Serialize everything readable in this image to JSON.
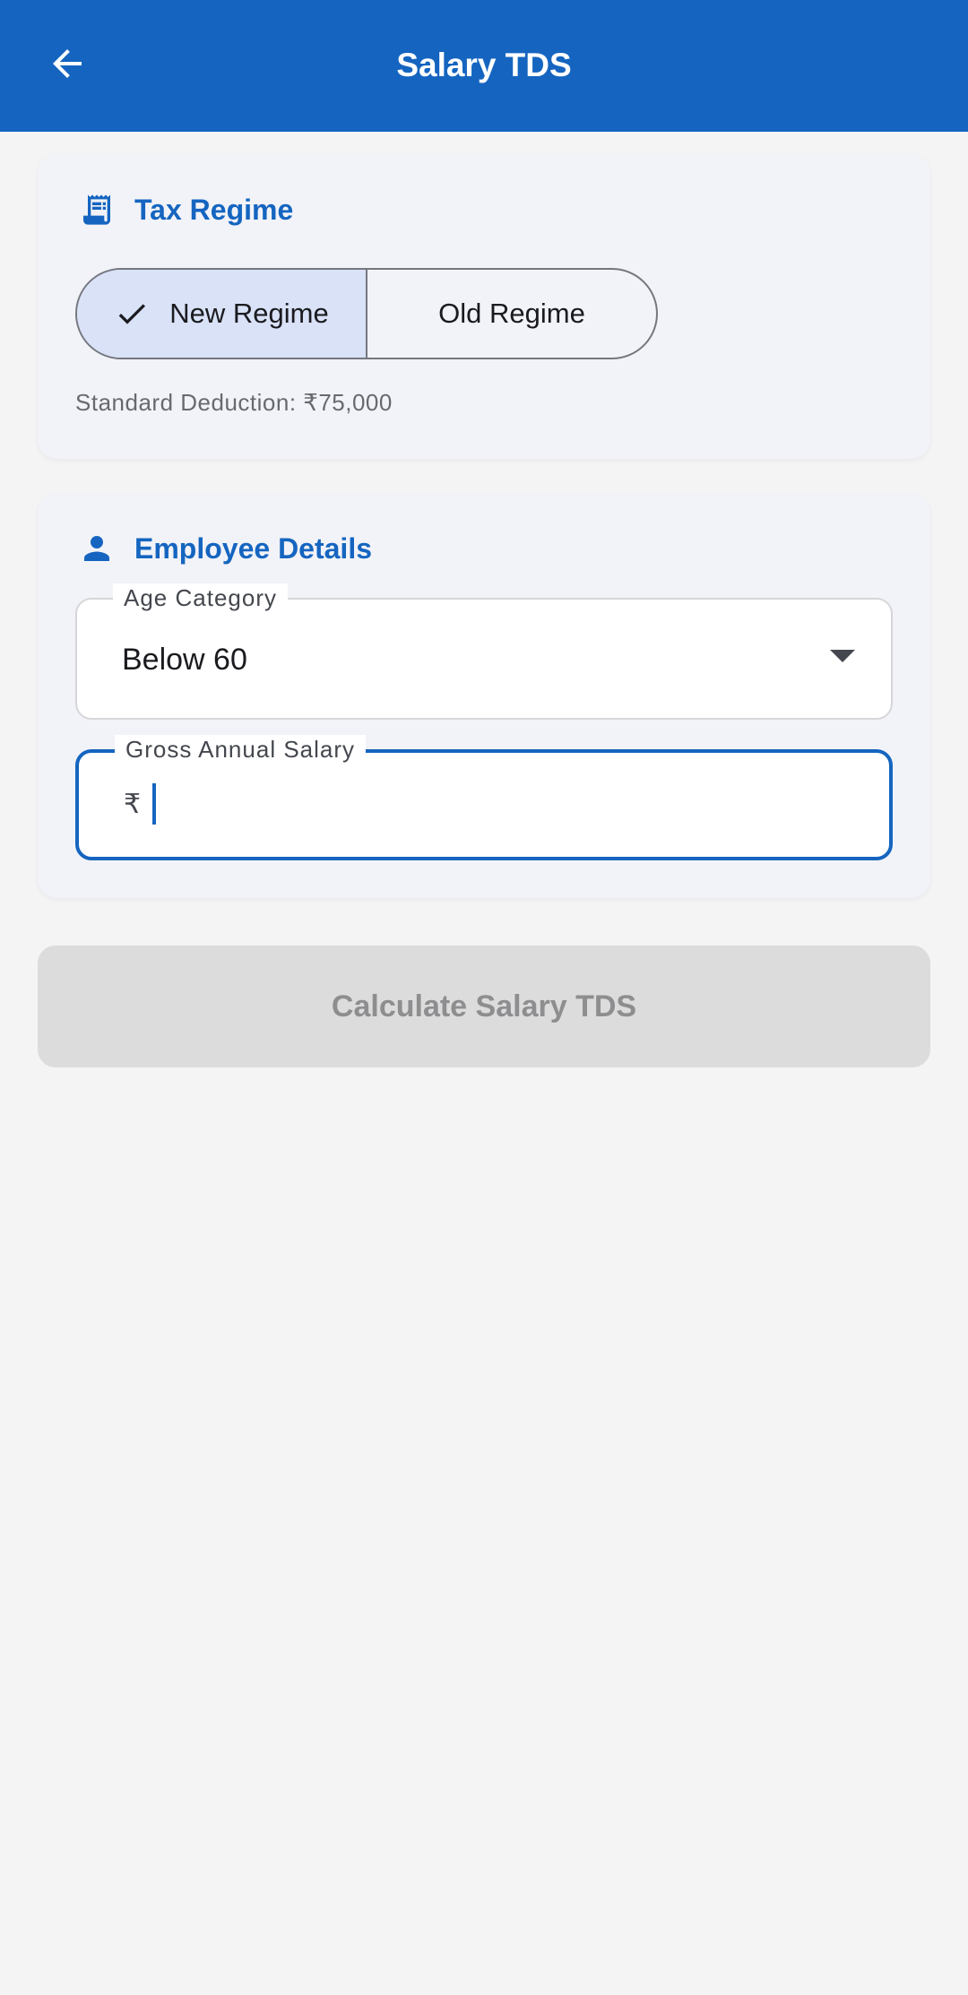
{
  "appbar": {
    "title": "Salary TDS",
    "back_icon": "arrow-left-icon"
  },
  "tax_regime": {
    "title": "Tax Regime",
    "icon": "receipt-icon",
    "options": [
      {
        "label": "New Regime",
        "selected": true
      },
      {
        "label": "Old Regime",
        "selected": false
      }
    ],
    "standard_deduction": "Standard Deduction: ₹75,000"
  },
  "employee": {
    "title": "Employee Details",
    "icon": "person-icon",
    "age_category": {
      "label": "Age Category",
      "value": "Below 60"
    },
    "gross_salary": {
      "label": "Gross Annual Salary",
      "prefix": "₹",
      "value": ""
    }
  },
  "calculate_button": {
    "label": "Calculate Salary TDS",
    "enabled": false
  },
  "colors": {
    "primary": "#1565c0",
    "background": "#f4f4f5",
    "card": "#f2f3f8",
    "selected_segment": "#d9e2f7",
    "disabled_button": "#dcdcdc"
  }
}
